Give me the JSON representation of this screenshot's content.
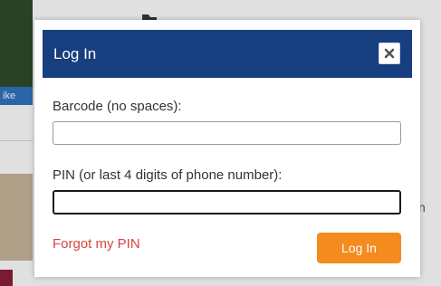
{
  "background": {
    "tag_text": "ike",
    "right_edge_letter": "n"
  },
  "modal": {
    "title": "Log In",
    "close_icon": "close-icon",
    "barcode_label": "Barcode (no spaces):",
    "barcode_value": "",
    "pin_label": "PIN (or last 4 digits of phone number):",
    "pin_value": "",
    "forgot_link": "Forgot my PIN",
    "login_button": "Log In"
  },
  "colors": {
    "header_bg": "#173e7f",
    "login_button_bg": "#f58a1f",
    "forgot_link": "#d9453d"
  }
}
